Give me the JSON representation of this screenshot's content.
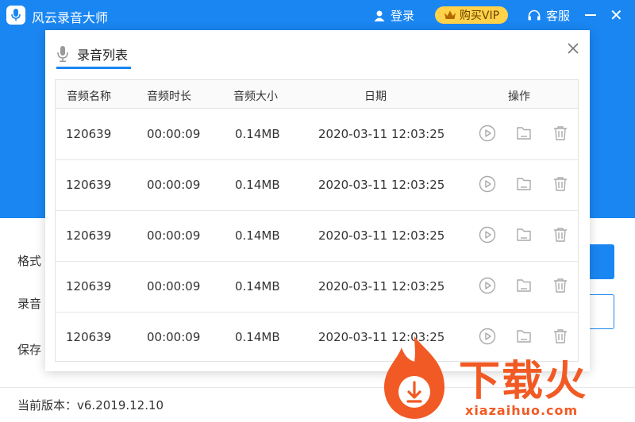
{
  "app": {
    "title": "风云录音大师",
    "login_label": "登录",
    "vip_label": "购买VIP",
    "service_label": "客服",
    "version_text": "当前版本：v6.2019.12.10",
    "side_labels": [
      "格式",
      "录音",
      "保存"
    ]
  },
  "modal": {
    "tab_label": "录音列表",
    "columns": [
      "音频名称",
      "音频时长",
      "音频大小",
      "日期",
      "操作"
    ],
    "rows": [
      {
        "name": "120639",
        "duration": "00:00:09",
        "size": "0.14MB",
        "date": "2020-03-11 12:03:25"
      },
      {
        "name": "120639",
        "duration": "00:00:09",
        "size": "0.14MB",
        "date": "2020-03-11 12:03:25"
      },
      {
        "name": "120639",
        "duration": "00:00:09",
        "size": "0.14MB",
        "date": "2020-03-11 12:03:25"
      },
      {
        "name": "120639",
        "duration": "00:00:09",
        "size": "0.14MB",
        "date": "2020-03-11 12:03:25"
      },
      {
        "name": "120639",
        "duration": "00:00:09",
        "size": "0.14MB",
        "date": "2020-03-11 12:03:25"
      }
    ]
  },
  "watermark": {
    "brand": "下载火",
    "url": "xiazaihuo.com"
  },
  "colors": {
    "primary": "#1a86f2",
    "vip": "#ffd24a",
    "watermark": "#f15a24"
  },
  "icons": [
    "microphone-icon",
    "user-icon",
    "crown-icon",
    "headset-icon",
    "minimize-icon",
    "close-icon",
    "play-icon",
    "folder-icon",
    "trash-icon"
  ]
}
